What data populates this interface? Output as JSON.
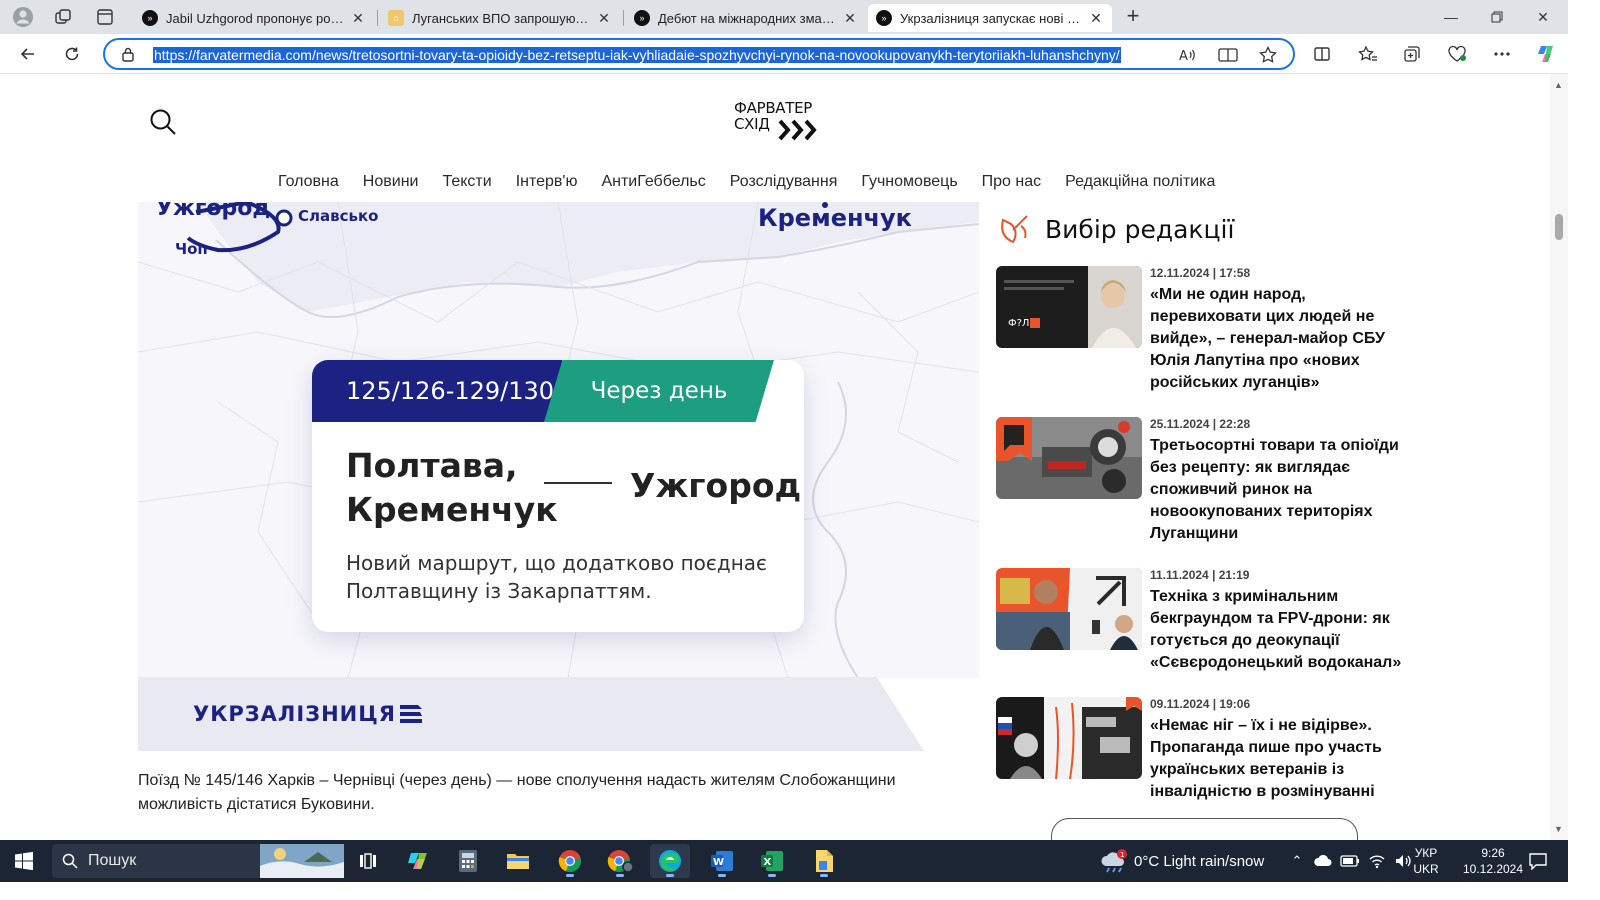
{
  "browser": {
    "tabs": [
      {
        "title": "Jabil Uzhgorod пропонує роботу",
        "favicon": "site-logo"
      },
      {
        "title": "Луганських ВПО запрошують на",
        "favicon": "home"
      },
      {
        "title": "Дебют на міжнародних змаганн",
        "favicon": "site-logo"
      },
      {
        "title": "Укрзалізниця запускає нові мар",
        "favicon": "site-logo"
      }
    ],
    "active_tab_index": 3,
    "url": "https://farvatermedia.com/news/tretosortni-tovary-ta-opioidy-bez-retseptu-iak-vyhliadaie-spozhyvchyi-rynok-na-novookupovanykh-terytoriiakh-luhanshchyny/",
    "accent": "#1a73e8"
  },
  "site": {
    "logo_line1": "ФАРВАТЕР",
    "logo_line2": "СХІД",
    "nav": [
      "Головна",
      "Новини",
      "Тексти",
      "Інтерв'ю",
      "АнтиГеббельс",
      "Розслідування",
      "Гучномовець",
      "Про нас",
      "Редакційна політика"
    ]
  },
  "hero": {
    "map_labels": {
      "uzhhorod": "Ужгород",
      "slavske": "Славсько",
      "chop": "Чоп",
      "kremenchuk": "Кременчук"
    },
    "route_number": "125/126-129/130",
    "frequency": "Через день",
    "from_line1": "Полтава,",
    "from_line2": "Кременчук",
    "to": "Ужгород",
    "description": "Новий маршрут, що додатково поєднає Полтавщину із Закарпаттям.",
    "brand_color": "#1c2282",
    "accent_green": "#1e9e80"
  },
  "banner": {
    "brand": "УКРЗАЛІЗНИЦЯ"
  },
  "article": {
    "paragraph": "Поїзд № 145/146 Харків – Чернівці (через день) — нове сполучення надасть жителям Слобожанщини можливість дістатися Буковини."
  },
  "picks": {
    "title": "Вибір редакції",
    "items": [
      {
        "date": "12.11.2024 | 17:58",
        "headline": "«Ми не один народ, перевиховати цих людей не вийде», – генерал-майор СБУ Юлія Лапутіна про «нових російських луганців»"
      },
      {
        "date": "25.11.2024 | 22:28",
        "headline": "Третьосортні товари та опіоїди без рецепту: як виглядає споживчий ринок на новоокупованих територіях Луганщини"
      },
      {
        "date": "11.11.2024 | 21:19",
        "headline": "Техніка з кримінальним бекграундом та FPV-дрони: як готується до деокупації «Сєвєродонецький водоканал»"
      },
      {
        "date": "09.11.2024 | 19:06",
        "headline": "«Немає ніг – їх і не відірве». Пропаганда пише про участь українських ветеранів із інвалідністю в розмінуванні"
      }
    ]
  },
  "taskbar": {
    "search_placeholder": "Пошук",
    "weather": "0°C  Light rain/snow",
    "weather_badge": "1",
    "lang_top": "УКР",
    "lang_bottom": "UKR",
    "time": "9:26",
    "date": "10.12.2024",
    "apps": [
      "copilot-icon",
      "calculator-icon",
      "file-explorer-icon",
      "chrome-icon",
      "chrome-profile-icon",
      "edge-icon",
      "word-icon",
      "excel-icon",
      "files-icon"
    ]
  }
}
